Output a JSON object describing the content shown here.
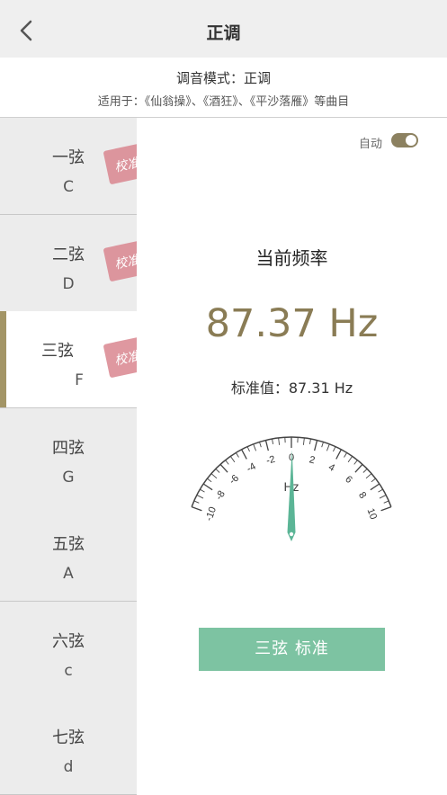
{
  "header": {
    "title": "正调",
    "back_icon": "chevron-left-icon"
  },
  "mode": {
    "label": "调音模式：",
    "value": "正调",
    "applies_to": "适用于：《仙翁操》、《酒狂》、《平沙落雁》等曲目"
  },
  "strings": [
    {
      "name": "一弦",
      "note": "C",
      "stamp": "校准",
      "active": false
    },
    {
      "name": "二弦",
      "note": "D",
      "stamp": "校准",
      "active": false
    },
    {
      "name": "三弦",
      "note": "F",
      "stamp": "校准",
      "active": true
    },
    {
      "name": "四弦",
      "note": "G",
      "stamp": "",
      "active": false
    },
    {
      "name": "五弦",
      "note": "A",
      "stamp": "",
      "active": false
    },
    {
      "name": "六弦",
      "note": "c",
      "stamp": "",
      "active": false
    },
    {
      "name": "七弦",
      "note": "d",
      "stamp": "",
      "active": false
    }
  ],
  "auto": {
    "label": "自动",
    "on": true
  },
  "frequency": {
    "label": "当前频率",
    "value": "87.37 Hz",
    "standard_label": "标准值：",
    "standard_value": "87.31 Hz"
  },
  "gauge": {
    "unit": "Hz",
    "tick_labels": [
      "-10",
      "-8",
      "-6",
      "-4",
      "-2",
      "0",
      "2",
      "4",
      "6",
      "8",
      "10"
    ],
    "min": -10,
    "max": 10,
    "needle_value": 0.06
  },
  "action": {
    "label": "三弦  标准"
  },
  "colors": {
    "accent": "#8a7c55",
    "button": "#7dc3a2",
    "needle": "#5bb596",
    "stamp": "#d9868f"
  }
}
